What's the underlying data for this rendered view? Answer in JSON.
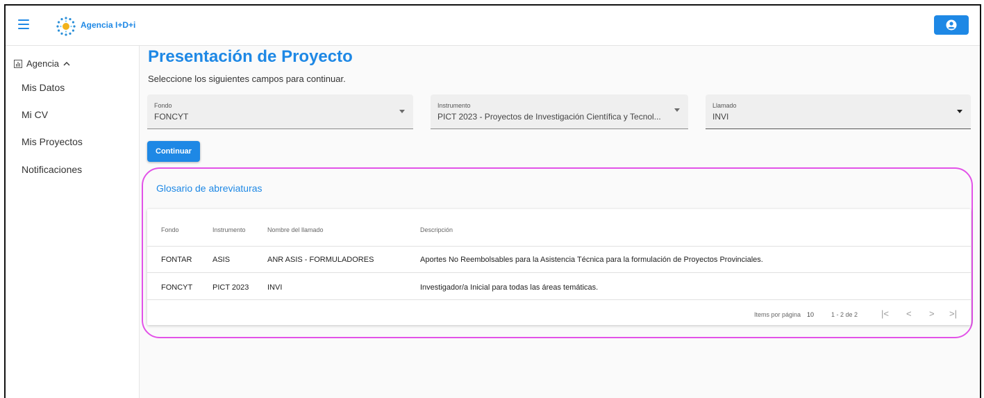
{
  "header": {
    "brand": "Agencia I+D+i"
  },
  "sidebar": {
    "section_label": "Agencia",
    "items": [
      {
        "label": "Mis Datos"
      },
      {
        "label": "Mi CV"
      },
      {
        "label": "Mis Proyectos"
      },
      {
        "label": "Notificaciones"
      }
    ]
  },
  "main": {
    "title": "Presentación de Proyecto",
    "subtitle": "Seleccione los siguientes campos para continuar.",
    "fields": [
      {
        "label": "Fondo",
        "value": "FONCYT"
      },
      {
        "label": "Instrumento",
        "value": "PICT 2023 - Proyectos de Investigación Científica y Tecnol..."
      },
      {
        "label": "Llamado",
        "value": "INVI"
      }
    ],
    "continue_label": "Continuar"
  },
  "glosario": {
    "title": "Glosario de abreviaturas",
    "columns": [
      "Fondo",
      "Instrumento",
      "Nombre del llamado",
      "Descripción"
    ],
    "rows": [
      [
        "FONTAR",
        "ASIS",
        "ANR ASIS - FORMULADORES",
        "Aportes No Reembolsables para la Asistencia Técnica para la formulación de Proyectos Provinciales."
      ],
      [
        "FONCYT",
        "PICT 2023",
        "INVI",
        "Investigador/a Inicial para todas las áreas temáticas."
      ]
    ],
    "paginator": {
      "items_label": "Items por página",
      "page_size": "10",
      "range": "1 - 2 de 2"
    }
  },
  "colors": {
    "accent": "#1e88e5",
    "highlight": "#e252e8"
  }
}
